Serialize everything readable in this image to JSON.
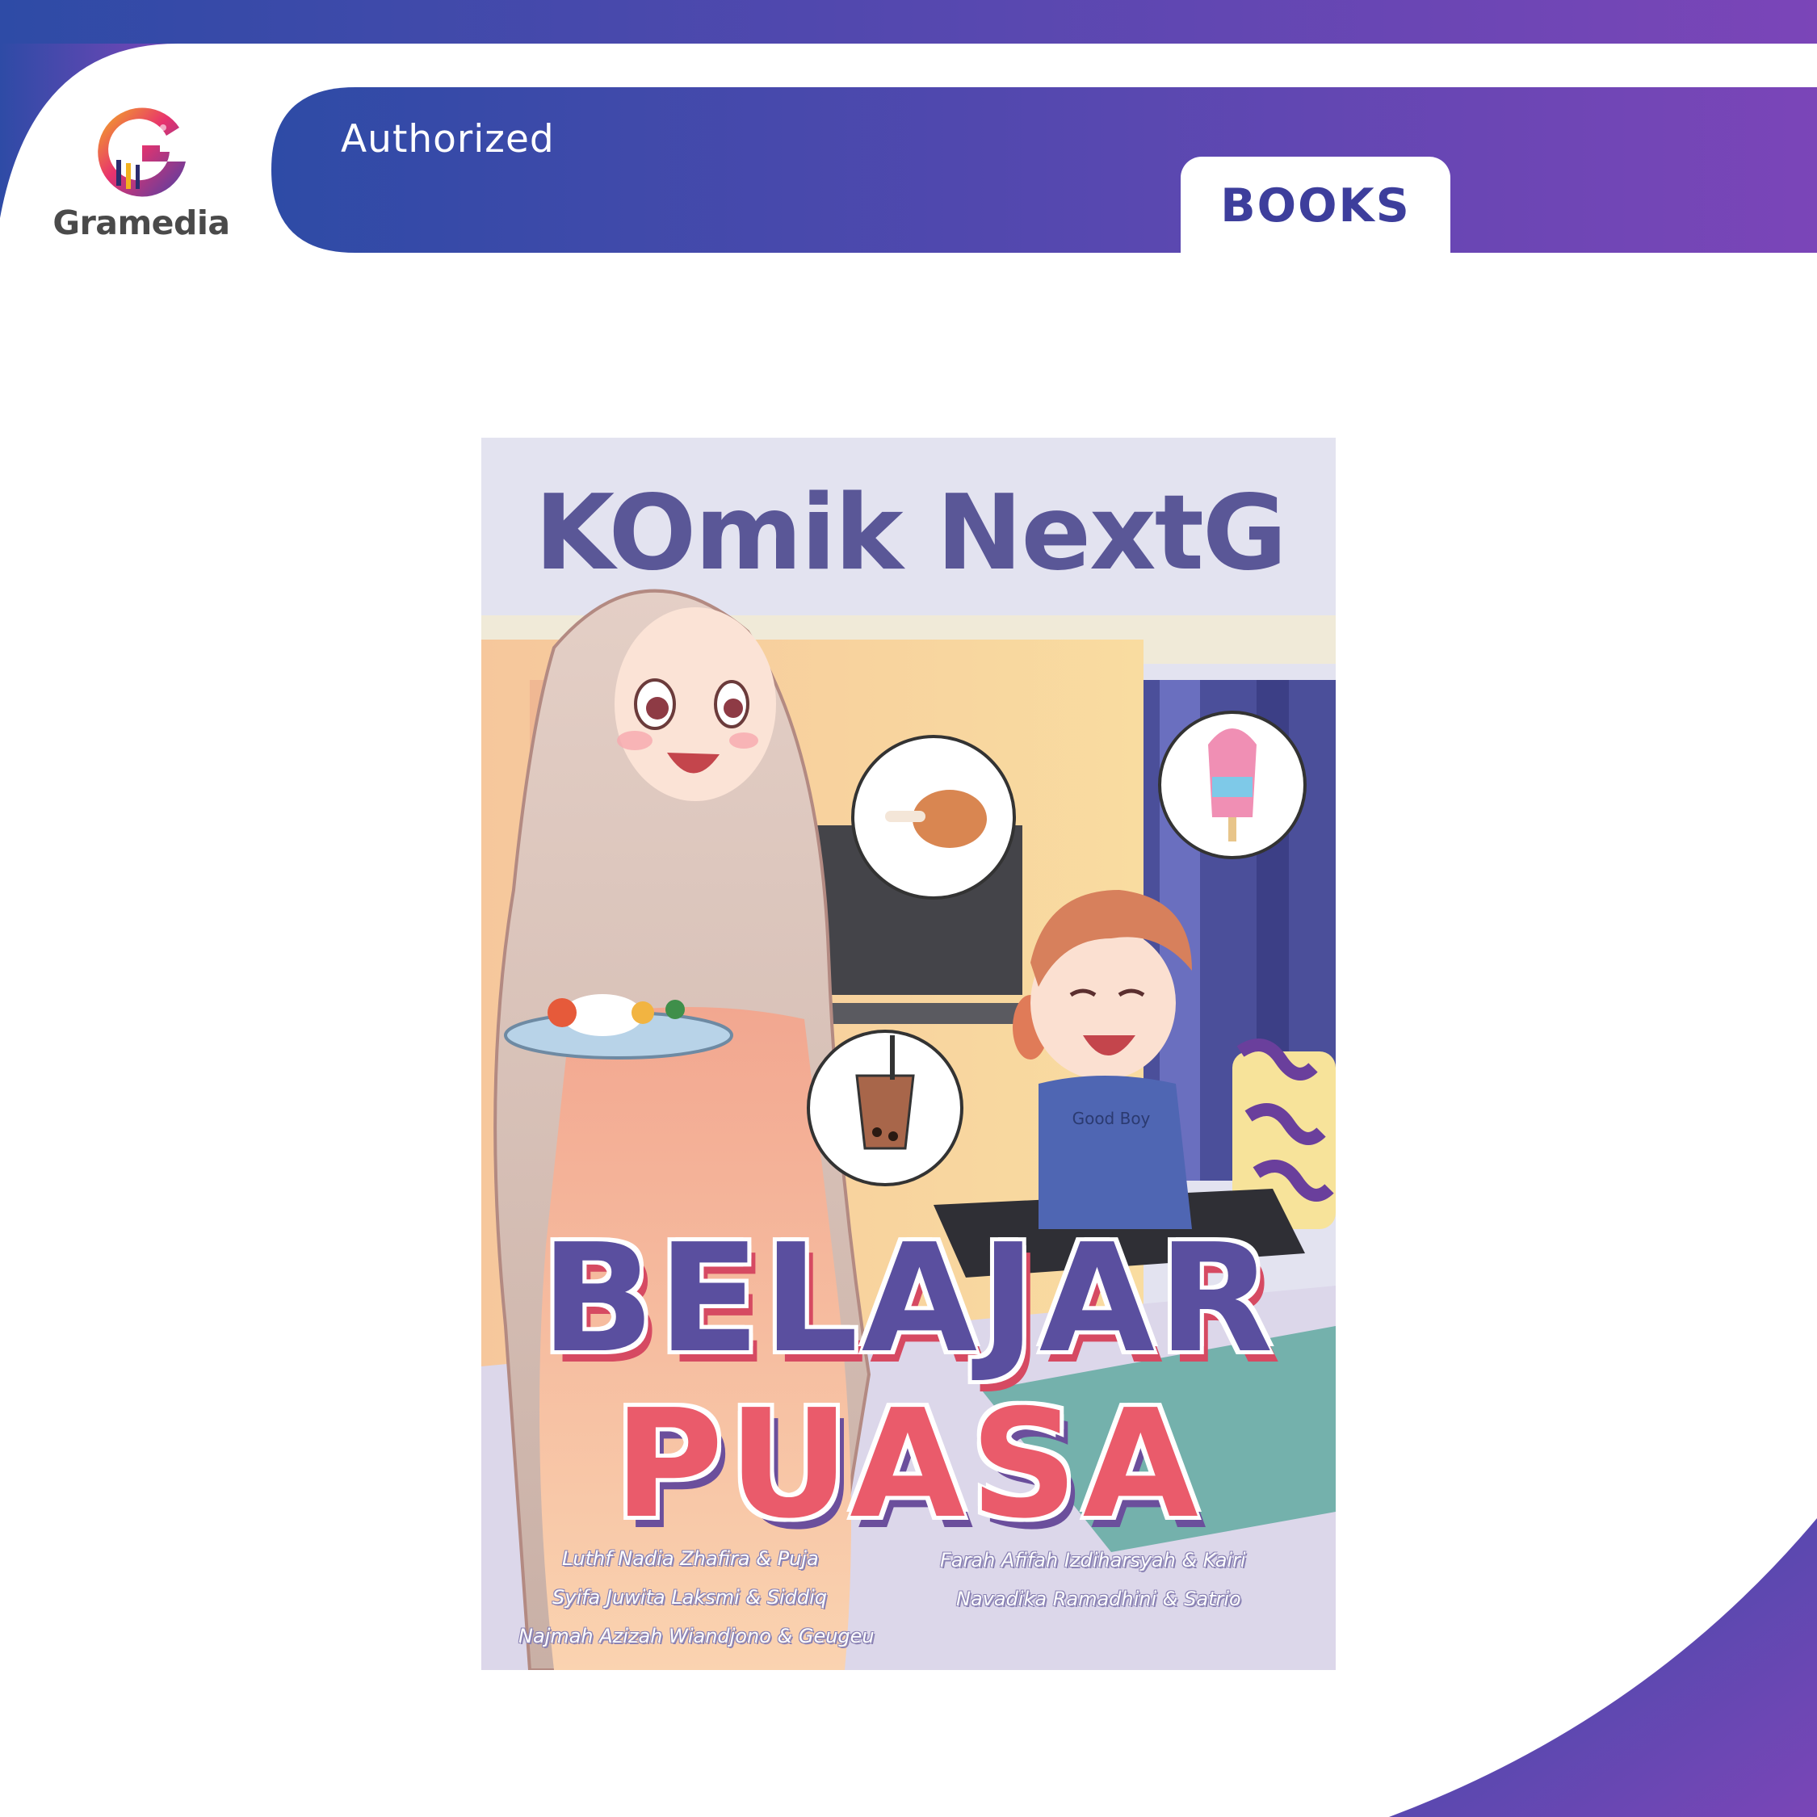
{
  "header": {
    "brand_name": "Gramedia",
    "badge_text": "Authorized",
    "category_tab": "BOOKS"
  },
  "colors": {
    "brand_gradient_start": "#2e4ba6",
    "brand_gradient_end": "#7b45b8",
    "tab_text": "#3d3e9c",
    "logo_text": "#4a4a4a"
  },
  "cover": {
    "series_title": "KOmik NextG",
    "title_line1": "BELAJAR",
    "title_line2": "PUASA",
    "authors_left": [
      "Luthf Nadia Zhafira & Puja",
      "Syifa Juwita Laksmi & Siddiq",
      "Najmah Azizah Wiandjono & Geugeu"
    ],
    "authors_right": [
      "Farah Afifah Izdiharsyah & Kairi",
      "Navadika Ramadhini & Satrio"
    ],
    "shirt_text": "Good Boy"
  }
}
